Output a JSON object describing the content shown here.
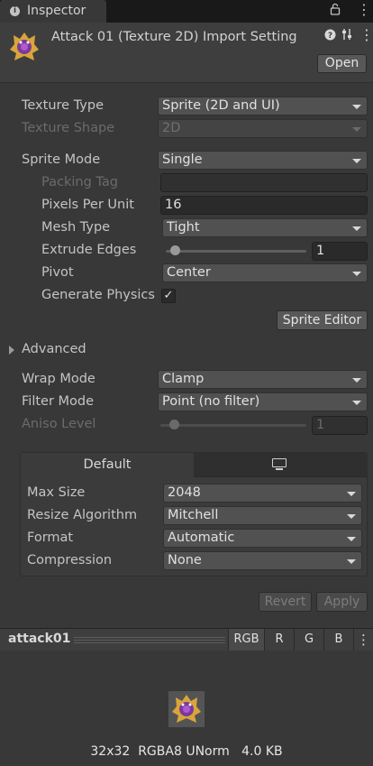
{
  "tab": {
    "title": "Inspector"
  },
  "header": {
    "title": "Attack 01 (Texture 2D) Import Setting",
    "open_label": "Open",
    "icons": [
      "help-icon",
      "preset-icon",
      "more-icon"
    ]
  },
  "props": {
    "texture_type": {
      "label": "Texture Type",
      "value": "Sprite (2D and UI)"
    },
    "texture_shape": {
      "label": "Texture Shape",
      "value": "2D"
    },
    "sprite_mode": {
      "label": "Sprite Mode",
      "value": "Single"
    },
    "packing_tag": {
      "label": "Packing Tag",
      "value": ""
    },
    "pixels_per_unit": {
      "label": "Pixels Per Unit",
      "value": "16"
    },
    "mesh_type": {
      "label": "Mesh Type",
      "value": "Tight"
    },
    "extrude_edges": {
      "label": "Extrude Edges",
      "value": "1",
      "slider_fraction": 0.03
    },
    "pivot": {
      "label": "Pivot",
      "value": "Center"
    },
    "generate_physics": {
      "label": "Generate Physics",
      "checked": true,
      "check_glyph": "✓"
    },
    "sprite_editor_label": "Sprite Editor",
    "advanced_label": "Advanced",
    "wrap_mode": {
      "label": "Wrap Mode",
      "value": "Clamp"
    },
    "filter_mode": {
      "label": "Filter Mode",
      "value": "Point (no filter)"
    },
    "aniso_level": {
      "label": "Aniso Level",
      "value": "1",
      "slider_fraction": 0.06
    }
  },
  "platform": {
    "tab_default": "Default",
    "tab_standalone_icon": "monitor-icon",
    "max_size": {
      "label": "Max Size",
      "value": "2048"
    },
    "resize_algorithm": {
      "label": "Resize Algorithm",
      "value": "Mitchell"
    },
    "format": {
      "label": "Format",
      "value": "Automatic"
    },
    "compression": {
      "label": "Compression",
      "value": "None"
    }
  },
  "actions": {
    "revert": "Revert",
    "apply": "Apply"
  },
  "preview": {
    "name": "attack01",
    "channels": [
      "RGB",
      "R",
      "G",
      "B"
    ],
    "info": "32x32  RGBA8 UNorm   4.0 KB"
  },
  "colors": {
    "accent_sprite": "#7a3a9a"
  }
}
